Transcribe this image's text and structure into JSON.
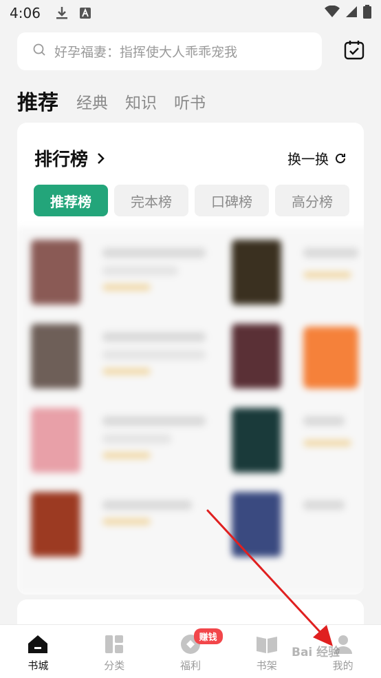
{
  "status_bar": {
    "time": "4:06",
    "icons": [
      "download-icon",
      "a-box-icon",
      "wifi-icon",
      "signal-icon",
      "battery-icon"
    ]
  },
  "search": {
    "placeholder": "好孕福妻：指挥使大人乖乖宠我",
    "icon": "search-icon"
  },
  "calendar": {
    "icon": "calendar-check-icon"
  },
  "tabs": [
    {
      "label": "推荐",
      "active": true
    },
    {
      "label": "经典",
      "active": false
    },
    {
      "label": "知识",
      "active": false
    },
    {
      "label": "听书",
      "active": false
    }
  ],
  "rank": {
    "title": "排行榜",
    "refresh_label": "换一换",
    "chips": [
      {
        "label": "推荐榜",
        "active": true
      },
      {
        "label": "完本榜",
        "active": false
      },
      {
        "label": "口碑榜",
        "active": false
      },
      {
        "label": "高分榜",
        "active": false
      }
    ]
  },
  "books": [
    {
      "cover_color": "#8a5a55"
    },
    {
      "cover_color": "#3a3020"
    },
    {
      "cover_color": "#6e5f58"
    },
    {
      "cover_color": "#5a3036"
    },
    {
      "cover_color": "#e8a0a8"
    },
    {
      "cover_color": "#1a3a3a"
    },
    {
      "cover_color": "#9c3a22"
    },
    {
      "cover_color": "#3a4a80"
    }
  ],
  "bottom_nav": [
    {
      "label": "书城",
      "icon": "home-icon",
      "active": true
    },
    {
      "label": "分类",
      "icon": "category-icon",
      "active": false
    },
    {
      "label": "福利",
      "icon": "gift-icon",
      "active": false,
      "badge": "赚钱"
    },
    {
      "label": "书架",
      "icon": "bookshelf-icon",
      "active": false
    },
    {
      "label": "我的",
      "icon": "user-icon",
      "active": false
    }
  ],
  "colors": {
    "accent": "#23a57a",
    "badge": "#f2464a",
    "annotation_arrow": "#e02020"
  },
  "watermark": "Bai 经验"
}
